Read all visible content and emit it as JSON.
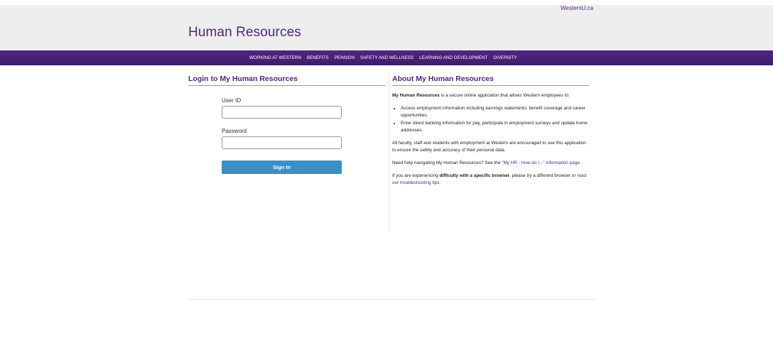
{
  "header": {
    "western_link": "WesternU.ca",
    "title": "Human Resources",
    "background": "#eeeeee",
    "title_color": "#4f2683"
  },
  "nav": {
    "background": "#4f2683",
    "items": [
      {
        "label": "WORKING AT WESTERN"
      },
      {
        "label": "BENEFITS"
      },
      {
        "label": "PENSION"
      },
      {
        "label": "SAFETY AND WELLNESS"
      },
      {
        "label": "LEARNING AND DEVELOPMENT"
      },
      {
        "label": "DIVERSITY"
      }
    ]
  },
  "login": {
    "title": "Login to My Human Resources",
    "userid_label": "User ID",
    "userid_value": "",
    "password_label": "Password",
    "password_value": "",
    "signin_label": "Sign In",
    "button_color": "#3a8fc6"
  },
  "about": {
    "title": "About My Human Resources",
    "intro_bold": "My Human Resources",
    "intro_rest": " is a secure online application that allows Western employees to:",
    "bullets": [
      "Access employment information including earnings statements, benefit coverage and career opportunities.",
      "Enter direct banking information for pay, participate in employment surveys and update home addresses."
    ],
    "para2": "All faculty, staff and students with employment at Western are encouraged to use this application to ensure the safety and accuracy of their personal data.",
    "para3_pre": "Need help navigating My Human Resources? See the ",
    "para3_link": "\"My HR - How do I...\" information page.",
    "para4_pre": "If you are experiencing ",
    "para4_bold": "difficulty with a specific browser",
    "para4_mid": ", please try a different browser or ",
    "para4_link": "read our troubleshooting tips."
  }
}
